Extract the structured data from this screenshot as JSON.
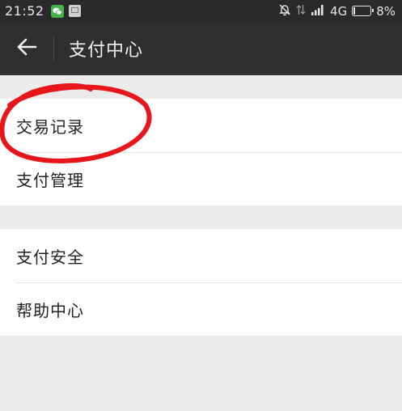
{
  "status_bar": {
    "time": "21:52",
    "network": "4G",
    "battery_percent_text": "8%",
    "battery_level": 0.08
  },
  "header": {
    "title": "支付中心",
    "back_icon": "arrow-left-icon"
  },
  "groups": [
    {
      "items": [
        {
          "label": "交易记录"
        },
        {
          "label": "支付管理"
        }
      ]
    },
    {
      "items": [
        {
          "label": "支付安全"
        },
        {
          "label": "帮助中心"
        }
      ]
    }
  ],
  "annotation": {
    "color": "#e8151b"
  }
}
